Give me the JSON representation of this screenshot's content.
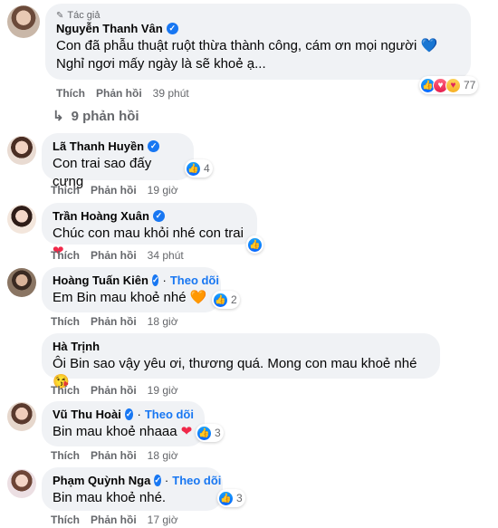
{
  "comments": [
    {
      "author_tag": "Tác giả",
      "author": "Nguyễn Thanh Vân",
      "text": "Con đã phẫu thuật ruột thừa thành công, cám ơn mọi người",
      "text_tail": " Nghỉ ngơi mấy ngày là sẽ khoẻ ạ...",
      "emoji": "💙",
      "like": "Thích",
      "reply": "Phản hồi",
      "time": "39 phút",
      "reaction_count": "77"
    },
    {
      "author": "Lã Thanh Huyền",
      "text": "Con trai sao đấy cưng",
      "like": "Thích",
      "reply": "Phản hồi",
      "time": "19 giờ",
      "reaction_count": "4"
    },
    {
      "author": "Trần Hoàng Xuân",
      "text": "Chúc con mau khỏi nhé con trai",
      "emoji": "❤",
      "like": "Thích",
      "reply": "Phản hồi",
      "time": "34 phút",
      "reaction_count": ""
    },
    {
      "author": "Hoàng Tuấn Kiên",
      "follow": "Theo dõi",
      "text": "Em Bin mau khoẻ nhé",
      "emoji": "🧡",
      "like": "Thích",
      "reply": "Phản hồi",
      "time": "18 giờ",
      "reaction_count": "2"
    },
    {
      "author": "Hà Trịnh",
      "text": "Ôi Bin sao vậy yêu ơi, thương quá. Mong con mau khoẻ nhé",
      "emoji": "😘",
      "like": "Thích",
      "reply": "Phản hồi",
      "time": "19 giờ"
    },
    {
      "author": "Vũ Thu Hoài",
      "follow": "Theo dõi",
      "text": "Bin mau khoẻ nhaaa",
      "emoji": "❤",
      "like": "Thích",
      "reply": "Phản hồi",
      "time": "18 giờ",
      "reaction_count": "3"
    },
    {
      "author": "Phạm Quỳnh Nga",
      "follow": "Theo dõi",
      "text": "Bin mau khoẻ nhé.",
      "like": "Thích",
      "reply": "Phản hồi",
      "time": "17 giờ",
      "reaction_count": "3"
    }
  ],
  "replies_link": "9 phản hồi",
  "icons": {
    "verified": "verified-badge-icon",
    "like": "like-reaction-icon",
    "love": "love-reaction-icon",
    "care": "care-reaction-icon",
    "reply_arrow": "reply-arrow-icon"
  },
  "colors": {
    "accent": "#1877f2",
    "bubble": "#f0f2f5",
    "muted": "#65676b"
  }
}
